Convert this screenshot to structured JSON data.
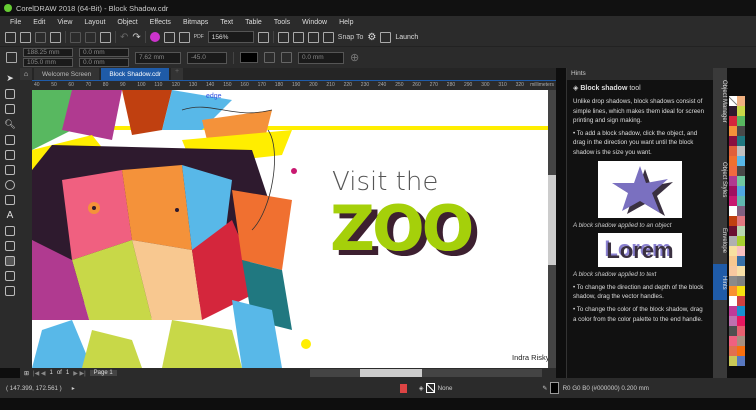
{
  "app": {
    "title": "CorelDRAW 2018 (64-Bit) - Block Shadow.cdr"
  },
  "menu": [
    "File",
    "Edit",
    "View",
    "Layout",
    "Object",
    "Effects",
    "Bitmaps",
    "Text",
    "Table",
    "Tools",
    "Window",
    "Help"
  ],
  "toolbar": {
    "zoom": "156%",
    "snap_to": "Snap To",
    "launch": "Launch"
  },
  "propbar": {
    "x": "188.25 mm",
    "y": "105.0 mm",
    "w": "0.0 mm",
    "h": "0.0 mm",
    "depth": "7.62 mm",
    "angle": "-45.0",
    "offset": "0.0 mm",
    "shadow_color": "#000000"
  },
  "tabs": [
    {
      "label": "Welcome Screen"
    },
    {
      "label": "Block Shadow.cdr",
      "active": true
    }
  ],
  "ruler": {
    "ticks": [
      "40",
      "50",
      "60",
      "70",
      "80",
      "90",
      "100",
      "110",
      "120",
      "130",
      "140",
      "150",
      "160",
      "170",
      "180",
      "190",
      "200",
      "210",
      "220",
      "230",
      "240",
      "250",
      "260",
      "270",
      "280",
      "290",
      "300",
      "310",
      "320"
    ],
    "unit": "millimeters"
  },
  "artwork": {
    "edge_label": "edge",
    "headline": "Visit the",
    "zoo": "ZOO",
    "credit": "Indra Risky",
    "green": "#a5d00a",
    "shadow": "#3d2030",
    "yellow": "#ffee00"
  },
  "pager": {
    "pos": "1",
    "of": "of",
    "total": "1",
    "page": "Page 1"
  },
  "hints": {
    "header": "Hints",
    "title_bold": "Block shadow",
    "title_rest": " tool",
    "p1": "Unlike drop shadows, block shadows consist of simple lines, which makes them ideal for screen printing and sign making.",
    "p2": "• To add a block shadow, click the object, and drag in the direction you want until the block shadow is the size you want.",
    "cap1": "A block shadow applied to an object",
    "lorem": "Lorem",
    "cap2": "A block shadow applied to text",
    "p3": "• To change the direction and depth of the block shadow, drag the vector handles.",
    "p4": "• To change the color of the block shadow, drag a color from the color palette to the end handle."
  },
  "dockers": [
    "Object Manager",
    "Object Styles",
    "Envelope",
    "Hints"
  ],
  "palette": [
    "none",
    "#f0b080",
    "#2e1a2e",
    "#c8d848",
    "#d4263c",
    "#58b860",
    "#f4923a",
    "#484848",
    "#8a1040",
    "#207880",
    "#e0603a",
    "#c0c0c0",
    "#f07030",
    "#58b8e8",
    "#f06a40",
    "#484848",
    "#b03a90",
    "#70c8a0",
    "#a01060",
    "#50a8e0",
    "#c81870",
    "#60b8b0",
    "#ffffff",
    "#806080",
    "#c04010",
    "#e07880",
    "#6a1030",
    "#b8d8b0",
    "#b0b0b0",
    "#a8d030",
    "#f8e0a0",
    "#f8c0c0",
    "#f8c890",
    "#3870a8",
    "#f8c8a0",
    "#f8e0a8",
    "#8a8a8a",
    "#808080",
    "#f89030",
    "#f8e010",
    "#ffffff",
    "#d04040",
    "#c03a98",
    "#1890d0",
    "#c070b0",
    "#e81860",
    "#505050",
    "#e86070",
    "#f06080",
    "#a89080",
    "#e07050",
    "#f87010",
    "#c8c858",
    "#5878c0"
  ],
  "status": {
    "coords": "( 147.399, 172.561 )",
    "fill": "None",
    "outline": "R0 G0 B0 (#000000)  0.200 mm"
  }
}
